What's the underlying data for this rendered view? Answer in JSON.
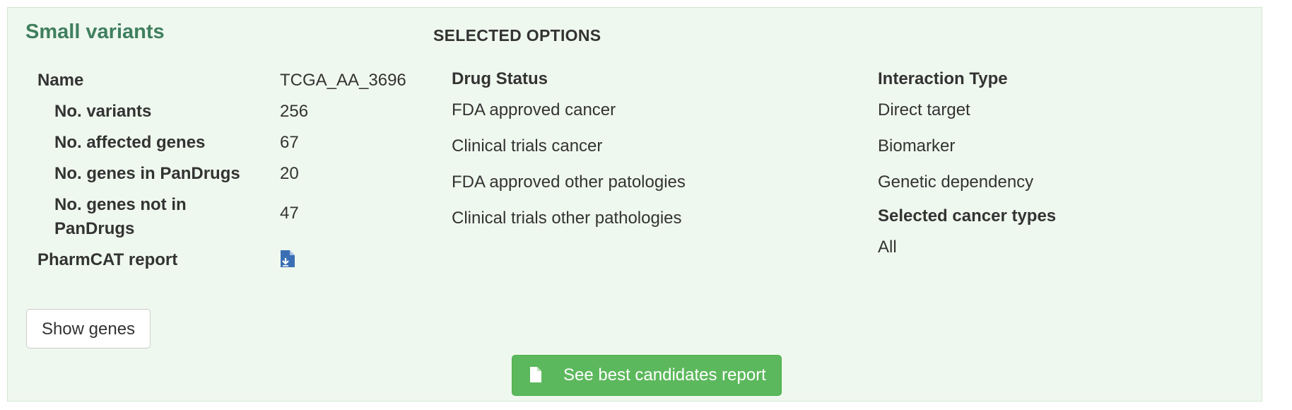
{
  "panel": {
    "title": "Small variants"
  },
  "summary": {
    "name_label": "Name",
    "name_value": "TCGA_AA_3696",
    "rows": [
      {
        "label": "No. variants",
        "value": "256"
      },
      {
        "label": "No. affected genes",
        "value": "67"
      },
      {
        "label": "No. genes in PanDrugs",
        "value": "20"
      },
      {
        "label": "No. genes not in PanDrugs",
        "value": "47"
      }
    ],
    "pharmcat_label": "PharmCAT report",
    "pharmcat_icon": "pdf-download-icon",
    "show_genes_label": "Show genes"
  },
  "selected_options": {
    "title": "SELECTED OPTIONS",
    "drug_status": {
      "header": "Drug Status",
      "items": [
        "FDA approved cancer",
        "Clinical trials cancer",
        "FDA approved other patologies",
        "Clinical trials other pathologies"
      ]
    },
    "interaction_type": {
      "header": "Interaction Type",
      "items": [
        "Direct target",
        "Biomarker",
        "Genetic dependency"
      ]
    },
    "cancer_types": {
      "header": "Selected cancer types",
      "items": [
        "All"
      ]
    }
  },
  "cta": {
    "label": "See best candidates report",
    "icon": "file-icon"
  },
  "colors": {
    "panel_bg": "#eff8ee",
    "title": "#3f7f5e",
    "cta": "#5cb85c",
    "icon_blue": "#3a6fb5"
  }
}
